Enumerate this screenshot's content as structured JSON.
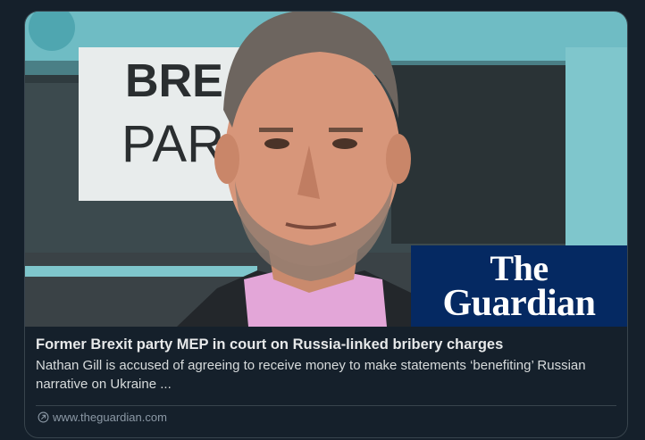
{
  "card": {
    "headline": "Former Brexit party MEP in court on Russia-linked bribery charges",
    "description": "Nathan Gill is accused of agreeing to receive money to make statements ‘benefiting’ Russian narrative on Ukraine ...",
    "source": "www.theguardian.com",
    "source_icon": "link-icon"
  },
  "media": {
    "sign_line1": "BRE",
    "sign_line2": "PAR",
    "logo_line1": "The",
    "logo_line2": "Guardian",
    "logo_color": "#052962"
  },
  "colors": {
    "background": "#15202b",
    "border": "#38444d",
    "headline": "#e7e9ea",
    "muted": "#8b98a5",
    "bus": "#7fc6cc"
  }
}
